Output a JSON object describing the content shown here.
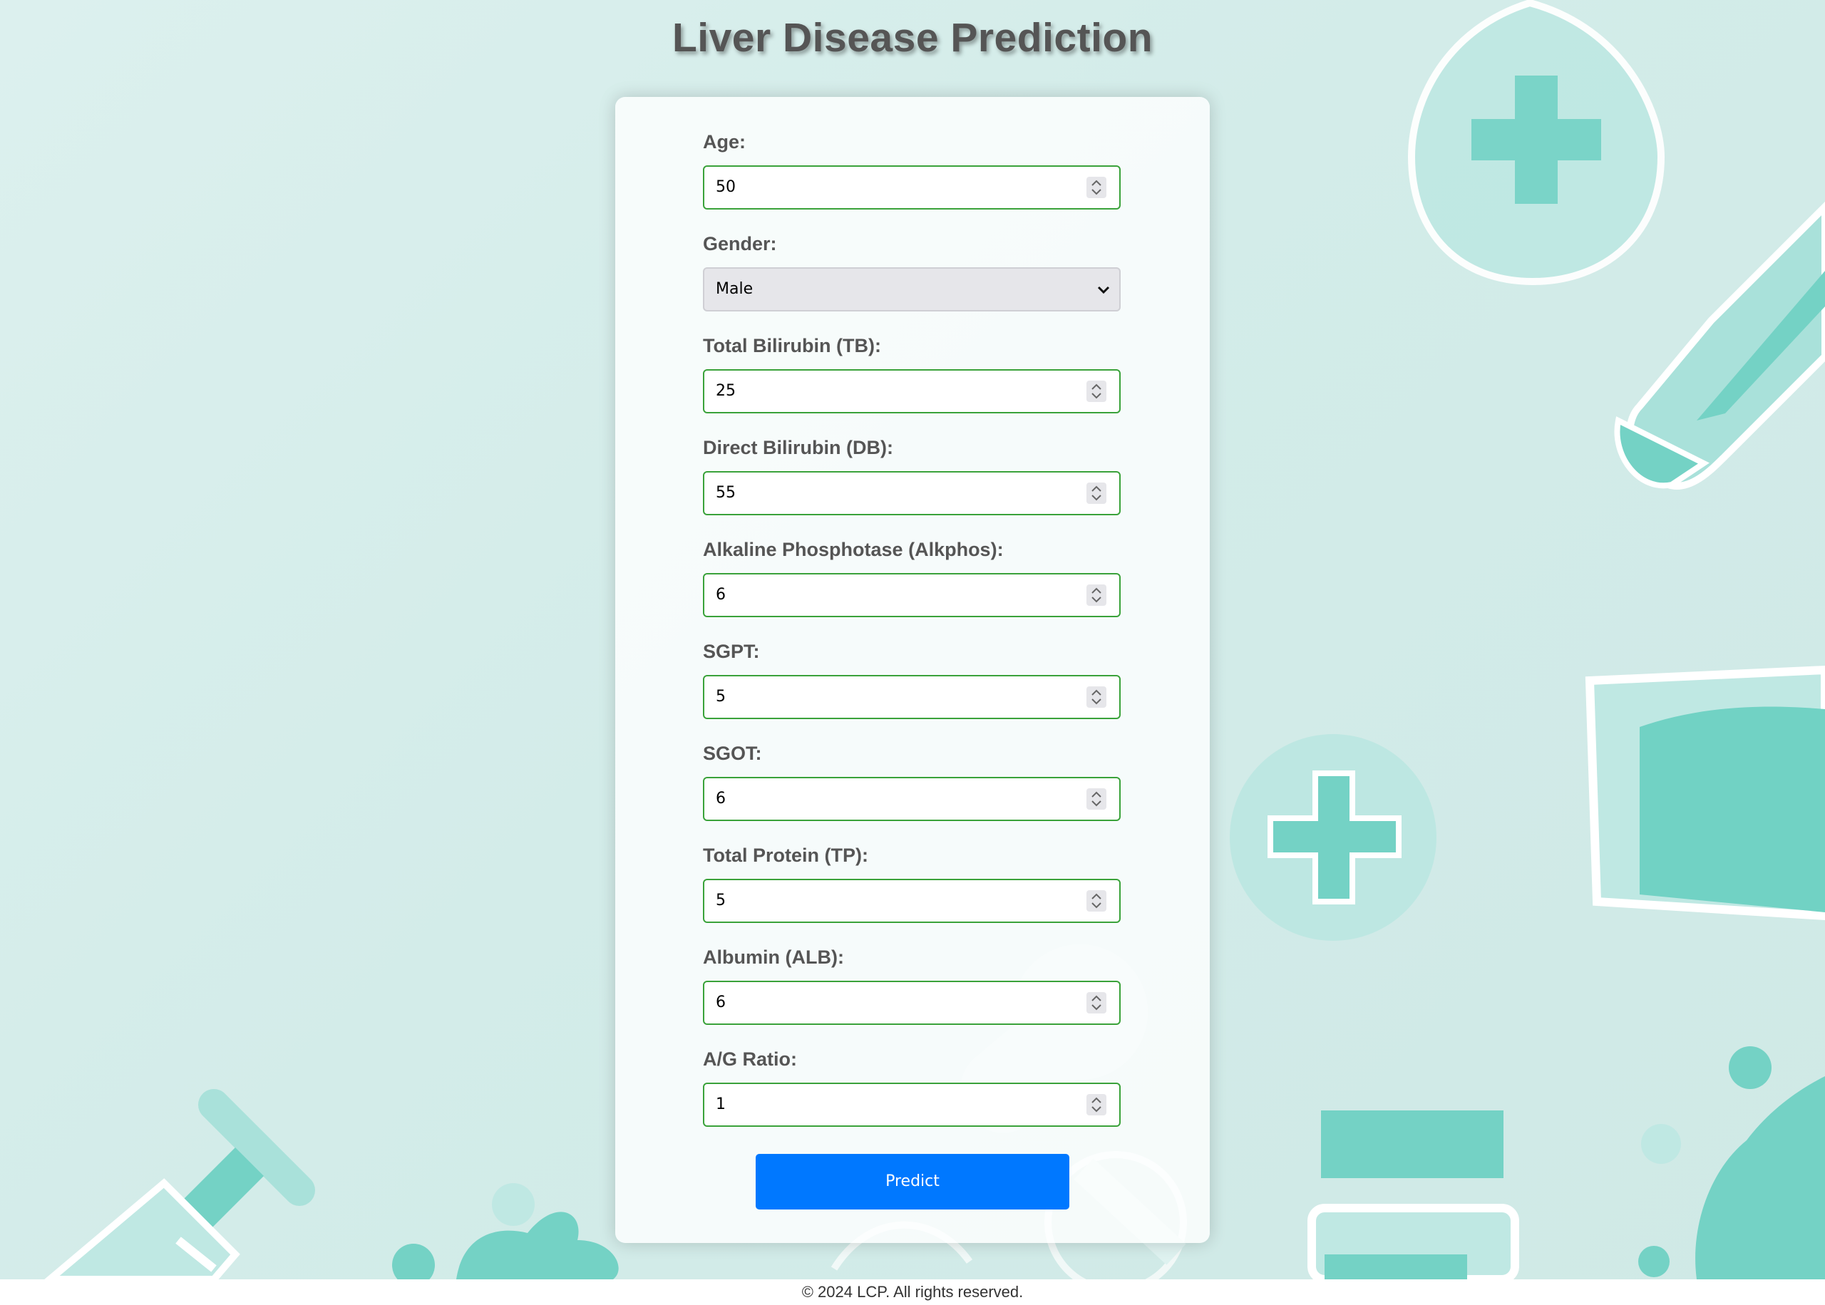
{
  "page": {
    "title": "Liver Disease Prediction"
  },
  "form": {
    "fields": [
      {
        "label": "Age:",
        "value": "50",
        "type": "number"
      },
      {
        "label": "Gender:",
        "value": "Male",
        "type": "select"
      },
      {
        "label": "Total Bilirubin (TB):",
        "value": "25",
        "type": "number"
      },
      {
        "label": "Direct Bilirubin (DB):",
        "value": "55",
        "type": "number"
      },
      {
        "label": "Alkaline Phosphotase (Alkphos):",
        "value": "6",
        "type": "number"
      },
      {
        "label": "SGPT:",
        "value": "5",
        "type": "number"
      },
      {
        "label": "SGOT:",
        "value": "6",
        "type": "number"
      },
      {
        "label": "Total Protein (TP):",
        "value": "5",
        "type": "number"
      },
      {
        "label": "Albumin (ALB):",
        "value": "6",
        "type": "number"
      },
      {
        "label": "A/G Ratio:",
        "value": "1",
        "type": "number"
      }
    ],
    "submit_label": "Predict"
  },
  "footer": {
    "text": "© 2024 LCP. All rights reserved."
  },
  "colors": {
    "accent": "#0078ff",
    "input_border": "#3aa23a",
    "title": "#555555",
    "background_teal": "#70d3c6"
  },
  "icons": [
    "spinner-arrows-icon",
    "chevron-down-icon",
    "medical-cross-icon",
    "syringe-icon",
    "virus-icon",
    "medicine-bottle-icon",
    "pill-icon",
    "dropper-icon"
  ]
}
